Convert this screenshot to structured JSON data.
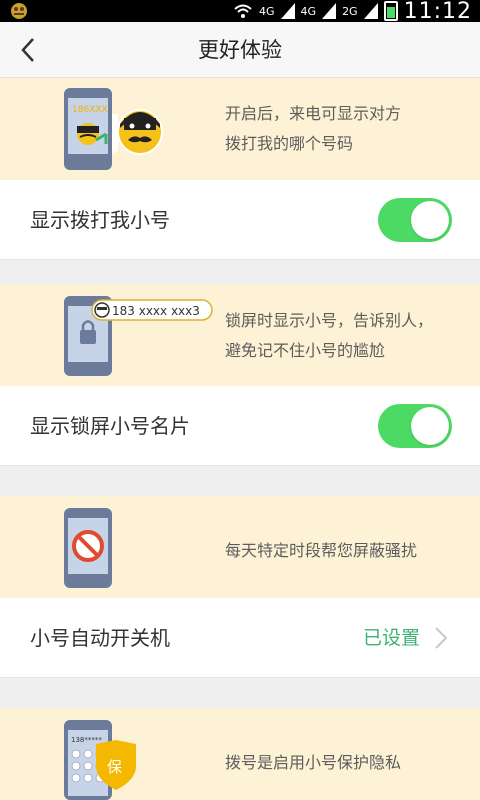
{
  "status_bar": {
    "network_labels": [
      "4G",
      "4G",
      "2G"
    ],
    "time": "11:12"
  },
  "header": {
    "back_icon": "chevron-left-icon",
    "title": "更好体验"
  },
  "sections": [
    {
      "banner": {
        "phone_text": "186XXX",
        "description_lines": [
          "开启后，来电可显示对方",
          "拨打我的哪个号码"
        ]
      },
      "row": {
        "label": "显示拨打我小号",
        "toggle_on": true
      }
    },
    {
      "banner": {
        "card_number": "183 xxxx xxx3",
        "description_lines": [
          "锁屏时显示小号，告诉别人，",
          "避免记不住小号的尴尬"
        ]
      },
      "row": {
        "label": "显示锁屏小号名片",
        "toggle_on": true
      }
    },
    {
      "banner": {
        "description_lines": [
          "每天特定时段帮您屏蔽骚扰"
        ]
      },
      "row": {
        "label": "小号自动开关机",
        "value": "已设置"
      }
    },
    {
      "banner": {
        "phone_text": "138*****",
        "shield_text": "保",
        "description_lines": [
          "拨号是启用小号保护隐私"
        ]
      }
    }
  ],
  "colors": {
    "banner_bg": "#fef2d6",
    "toggle_on": "#4cd964",
    "value_text": "#3cb371",
    "phone_body": "#6b7b99"
  }
}
